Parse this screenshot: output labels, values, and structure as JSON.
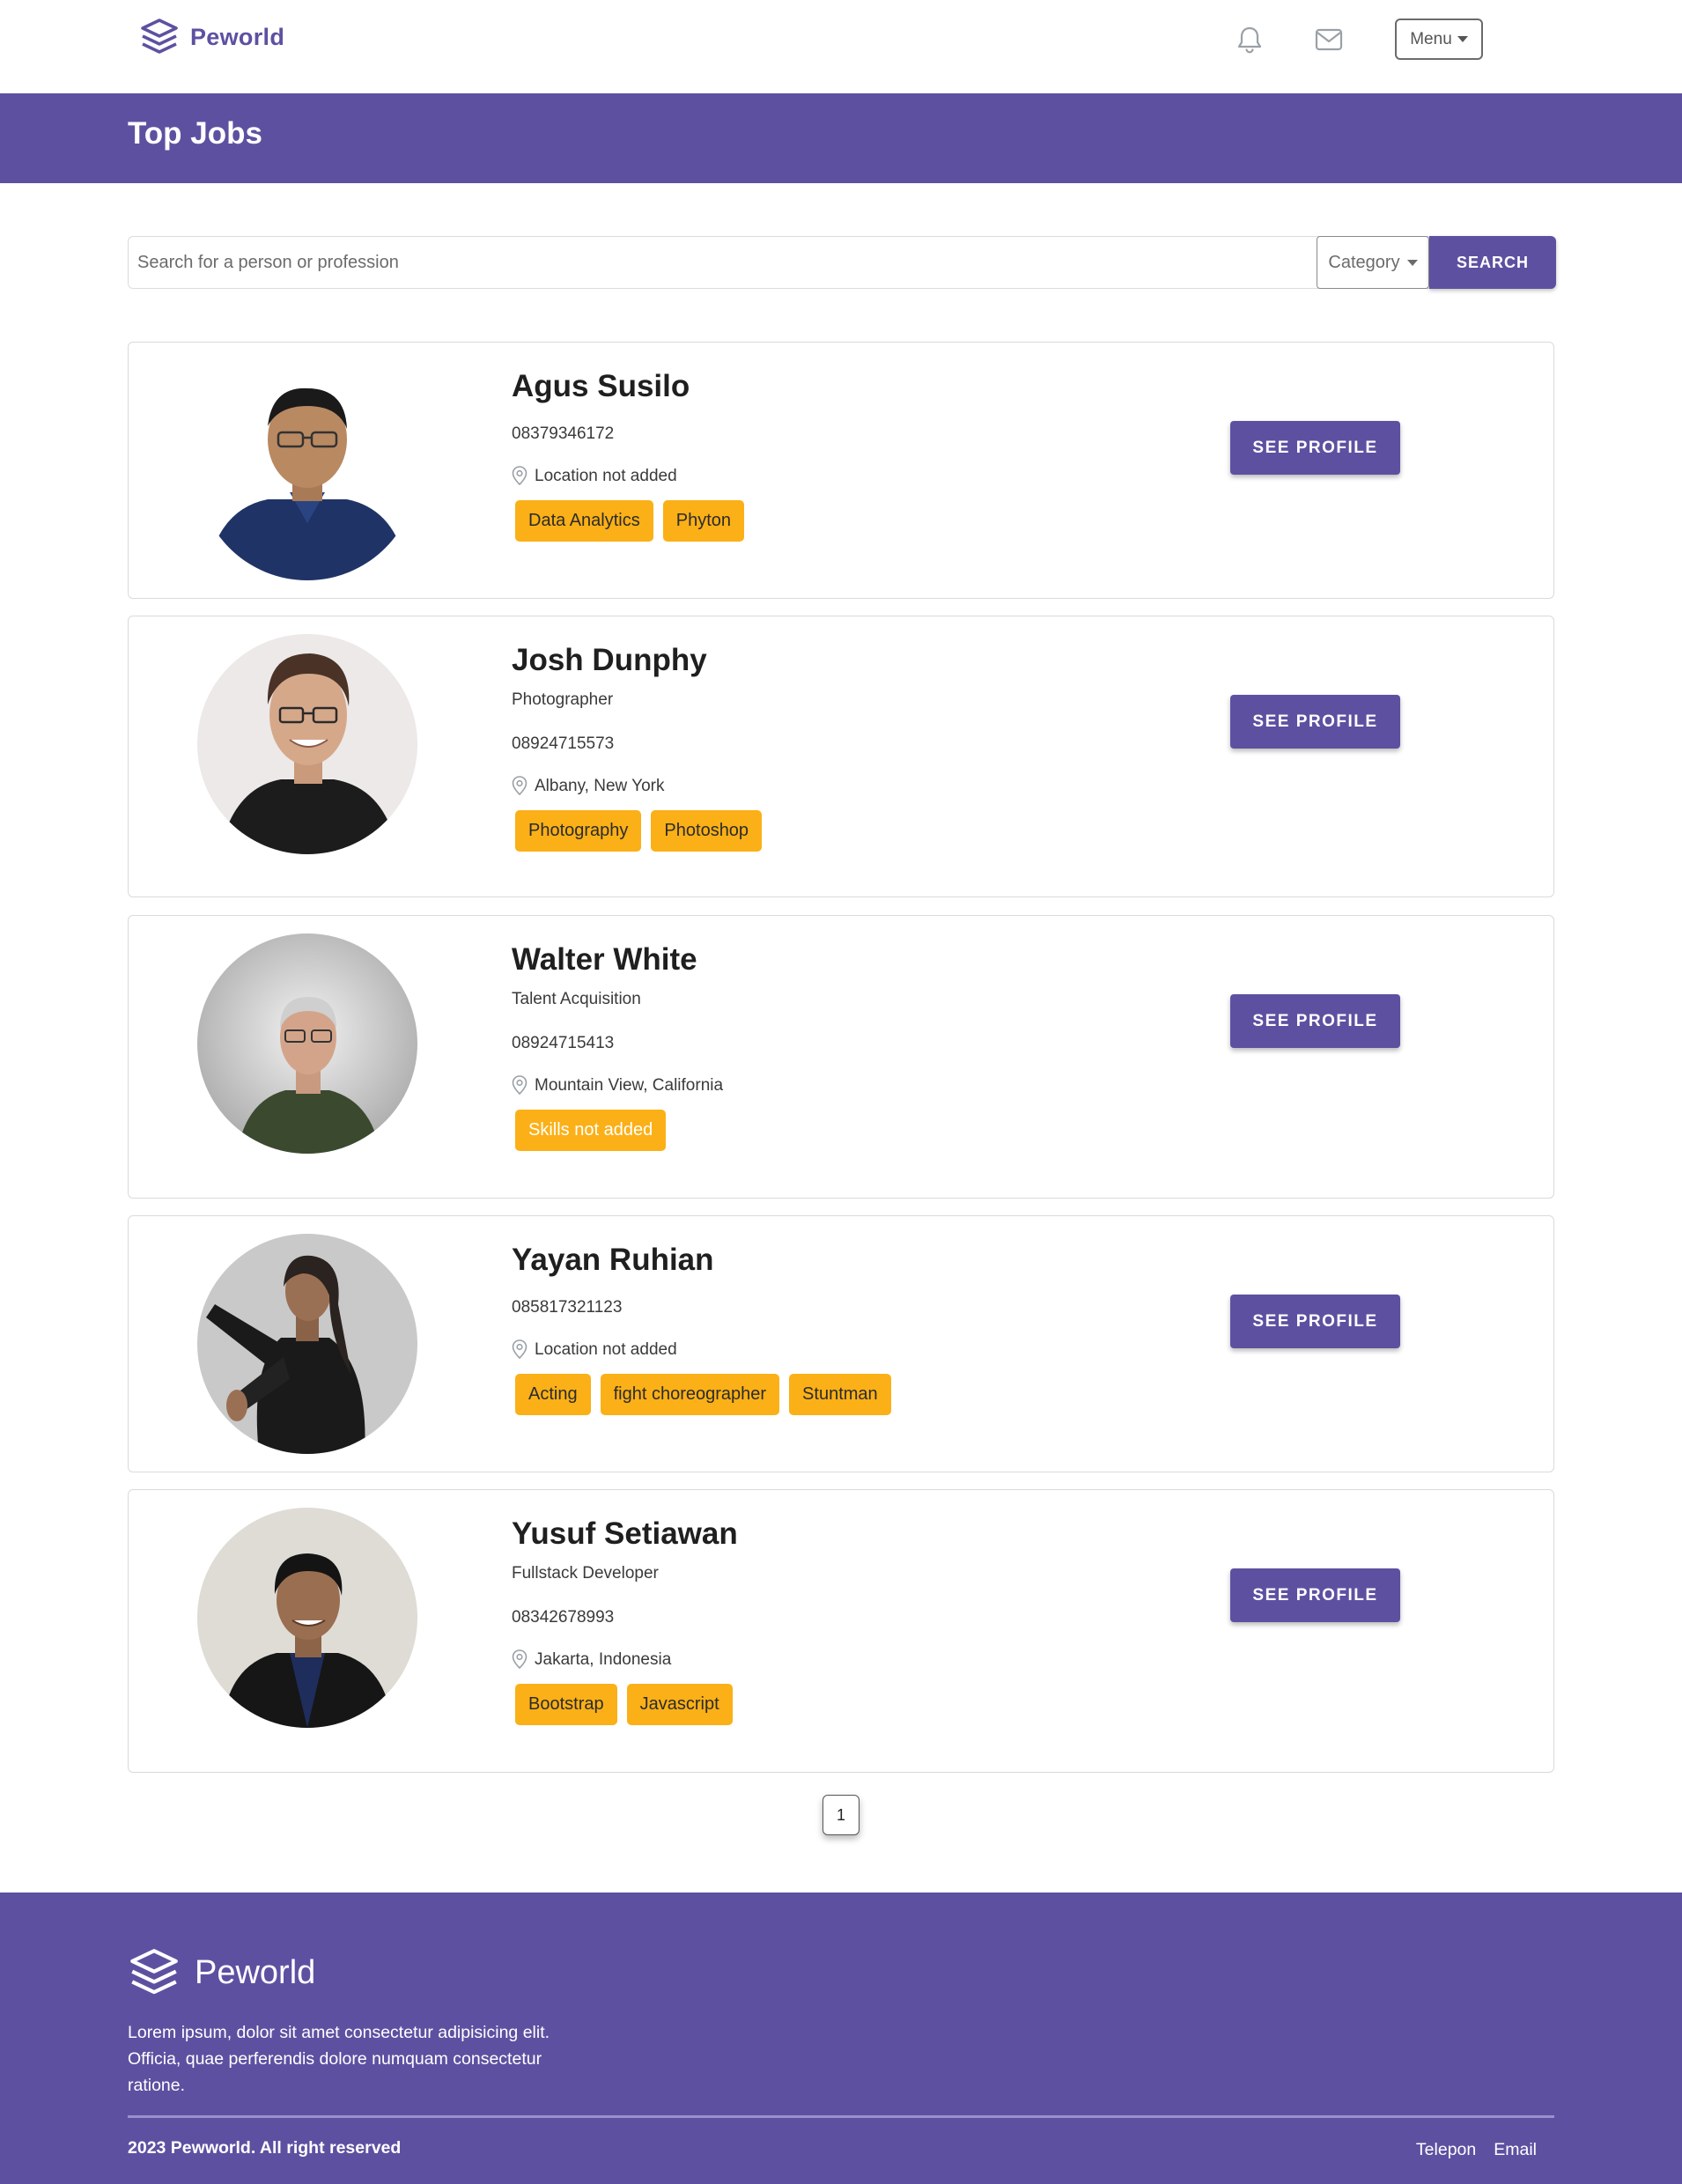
{
  "brand": {
    "name": "Peworld"
  },
  "nav": {
    "menu_label": "Menu"
  },
  "banner": {
    "title": "Top Jobs"
  },
  "search": {
    "placeholder": "Search for a person or profession",
    "category_label": "Category",
    "button_label": "SEARCH"
  },
  "see_profile_label": "SEE PROFILE",
  "profiles": [
    {
      "name": "Agus Susilo",
      "phone": "08379346172",
      "location": "Location not added",
      "skills": [
        "Data Analytics",
        "Phyton"
      ]
    },
    {
      "name": "Josh Dunphy",
      "job": "Photographer",
      "phone": "08924715573",
      "location": "Albany, New York",
      "skills": [
        "Photography",
        "Photoshop"
      ]
    },
    {
      "name": "Walter White",
      "job": "Talent Acquisition",
      "phone": "08924715413",
      "location": "Mountain View, California",
      "skills": [
        "Skills not added"
      ]
    },
    {
      "name": "Yayan Ruhian",
      "phone": "085817321123",
      "location": "Location not added",
      "skills": [
        "Acting",
        "fight choreographer",
        "Stuntman"
      ]
    },
    {
      "name": "Yusuf Setiawan",
      "job": "Fullstack Developer",
      "phone": "08342678993",
      "location": "Jakarta, Indonesia",
      "skills": [
        "Bootstrap",
        "Javascript"
      ]
    }
  ],
  "pagination": {
    "current": "1"
  },
  "footer": {
    "brand": "Peworld",
    "description": "Lorem ipsum, dolor sit amet consectetur adipisicing elit. Officia, quae perferendis dolore numquam consectetur ratione.",
    "copyright": "2023 Pewworld. All right reserved",
    "links": [
      "Telepon",
      "Email"
    ]
  },
  "colors": {
    "primary": "#5e50a1",
    "skill": "#fbb017"
  },
  "icons": [
    "logo-icon",
    "bell-icon",
    "mail-icon",
    "location-pin-icon"
  ]
}
